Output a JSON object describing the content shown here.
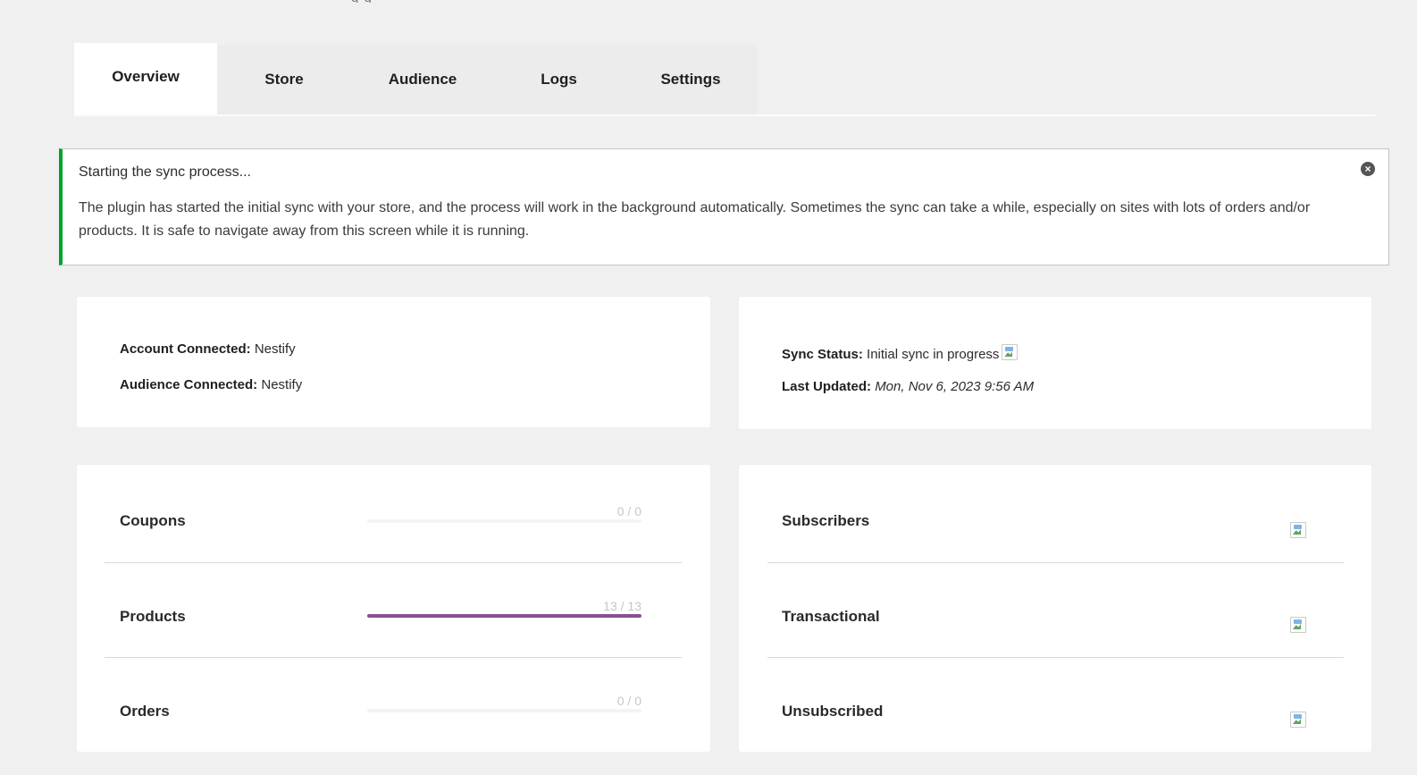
{
  "top_cut_text": "g g",
  "tabs": [
    {
      "label": "Overview",
      "active": true
    },
    {
      "label": "Store",
      "active": false
    },
    {
      "label": "Audience",
      "active": false
    },
    {
      "label": "Logs",
      "active": false
    },
    {
      "label": "Settings",
      "active": false
    }
  ],
  "notice": {
    "title": "Starting the sync process...",
    "text": "The plugin has started the initial sync with your store, and the process will work in the background automatically. Sometimes the sync can take a while, especially on sites with lots of orders and/or products. It is safe to navigate away from this screen while it is running.",
    "accent_color": "#00a32a"
  },
  "account": {
    "account_label": "Account Connected:",
    "account_value": "Nestify",
    "audience_label": "Audience Connected:",
    "audience_value": "Nestify"
  },
  "sync": {
    "status_label": "Sync Status:",
    "status_value": "Initial sync in progress",
    "updated_label": "Last Updated:",
    "updated_value": "Mon, Nov 6, 2023 9:56 AM"
  },
  "sync_items": [
    {
      "label": "Coupons",
      "count": "0 / 0",
      "progress": 0
    },
    {
      "label": "Products",
      "count": "13 / 13",
      "progress": 1
    },
    {
      "label": "Orders",
      "count": "0 / 0",
      "progress": 0
    }
  ],
  "audience_stats": [
    {
      "label": "Subscribers"
    },
    {
      "label": "Transactional"
    },
    {
      "label": "Unsubscribed"
    }
  ],
  "colors": {
    "progress_fill": "#8b4f8f",
    "background": "#f0f0f0"
  }
}
